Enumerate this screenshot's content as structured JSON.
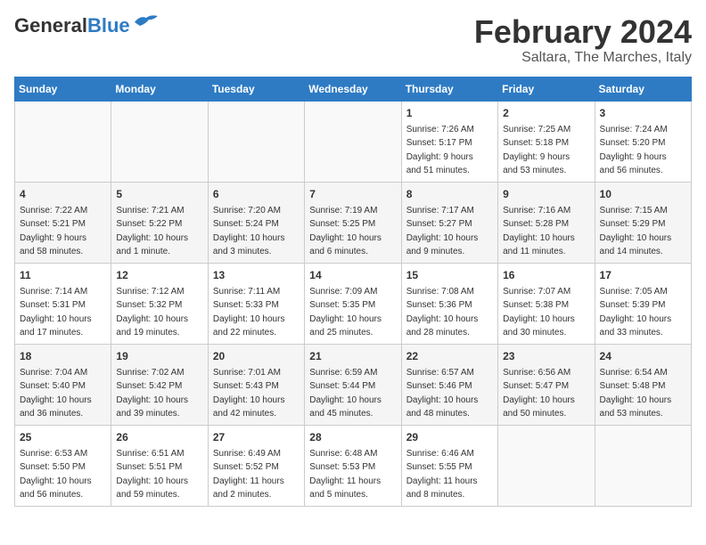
{
  "logo": {
    "general": "General",
    "blue": "Blue"
  },
  "title": "February 2024",
  "location": "Saltara, The Marches, Italy",
  "days_of_week": [
    "Sunday",
    "Monday",
    "Tuesday",
    "Wednesday",
    "Thursday",
    "Friday",
    "Saturday"
  ],
  "weeks": [
    [
      {
        "day": "",
        "info": ""
      },
      {
        "day": "",
        "info": ""
      },
      {
        "day": "",
        "info": ""
      },
      {
        "day": "",
        "info": ""
      },
      {
        "day": "1",
        "info": "Sunrise: 7:26 AM\nSunset: 5:17 PM\nDaylight: 9 hours\nand 51 minutes."
      },
      {
        "day": "2",
        "info": "Sunrise: 7:25 AM\nSunset: 5:18 PM\nDaylight: 9 hours\nand 53 minutes."
      },
      {
        "day": "3",
        "info": "Sunrise: 7:24 AM\nSunset: 5:20 PM\nDaylight: 9 hours\nand 56 minutes."
      }
    ],
    [
      {
        "day": "4",
        "info": "Sunrise: 7:22 AM\nSunset: 5:21 PM\nDaylight: 9 hours\nand 58 minutes."
      },
      {
        "day": "5",
        "info": "Sunrise: 7:21 AM\nSunset: 5:22 PM\nDaylight: 10 hours\nand 1 minute."
      },
      {
        "day": "6",
        "info": "Sunrise: 7:20 AM\nSunset: 5:24 PM\nDaylight: 10 hours\nand 3 minutes."
      },
      {
        "day": "7",
        "info": "Sunrise: 7:19 AM\nSunset: 5:25 PM\nDaylight: 10 hours\nand 6 minutes."
      },
      {
        "day": "8",
        "info": "Sunrise: 7:17 AM\nSunset: 5:27 PM\nDaylight: 10 hours\nand 9 minutes."
      },
      {
        "day": "9",
        "info": "Sunrise: 7:16 AM\nSunset: 5:28 PM\nDaylight: 10 hours\nand 11 minutes."
      },
      {
        "day": "10",
        "info": "Sunrise: 7:15 AM\nSunset: 5:29 PM\nDaylight: 10 hours\nand 14 minutes."
      }
    ],
    [
      {
        "day": "11",
        "info": "Sunrise: 7:14 AM\nSunset: 5:31 PM\nDaylight: 10 hours\nand 17 minutes."
      },
      {
        "day": "12",
        "info": "Sunrise: 7:12 AM\nSunset: 5:32 PM\nDaylight: 10 hours\nand 19 minutes."
      },
      {
        "day": "13",
        "info": "Sunrise: 7:11 AM\nSunset: 5:33 PM\nDaylight: 10 hours\nand 22 minutes."
      },
      {
        "day": "14",
        "info": "Sunrise: 7:09 AM\nSunset: 5:35 PM\nDaylight: 10 hours\nand 25 minutes."
      },
      {
        "day": "15",
        "info": "Sunrise: 7:08 AM\nSunset: 5:36 PM\nDaylight: 10 hours\nand 28 minutes."
      },
      {
        "day": "16",
        "info": "Sunrise: 7:07 AM\nSunset: 5:38 PM\nDaylight: 10 hours\nand 30 minutes."
      },
      {
        "day": "17",
        "info": "Sunrise: 7:05 AM\nSunset: 5:39 PM\nDaylight: 10 hours\nand 33 minutes."
      }
    ],
    [
      {
        "day": "18",
        "info": "Sunrise: 7:04 AM\nSunset: 5:40 PM\nDaylight: 10 hours\nand 36 minutes."
      },
      {
        "day": "19",
        "info": "Sunrise: 7:02 AM\nSunset: 5:42 PM\nDaylight: 10 hours\nand 39 minutes."
      },
      {
        "day": "20",
        "info": "Sunrise: 7:01 AM\nSunset: 5:43 PM\nDaylight: 10 hours\nand 42 minutes."
      },
      {
        "day": "21",
        "info": "Sunrise: 6:59 AM\nSunset: 5:44 PM\nDaylight: 10 hours\nand 45 minutes."
      },
      {
        "day": "22",
        "info": "Sunrise: 6:57 AM\nSunset: 5:46 PM\nDaylight: 10 hours\nand 48 minutes."
      },
      {
        "day": "23",
        "info": "Sunrise: 6:56 AM\nSunset: 5:47 PM\nDaylight: 10 hours\nand 50 minutes."
      },
      {
        "day": "24",
        "info": "Sunrise: 6:54 AM\nSunset: 5:48 PM\nDaylight: 10 hours\nand 53 minutes."
      }
    ],
    [
      {
        "day": "25",
        "info": "Sunrise: 6:53 AM\nSunset: 5:50 PM\nDaylight: 10 hours\nand 56 minutes."
      },
      {
        "day": "26",
        "info": "Sunrise: 6:51 AM\nSunset: 5:51 PM\nDaylight: 10 hours\nand 59 minutes."
      },
      {
        "day": "27",
        "info": "Sunrise: 6:49 AM\nSunset: 5:52 PM\nDaylight: 11 hours\nand 2 minutes."
      },
      {
        "day": "28",
        "info": "Sunrise: 6:48 AM\nSunset: 5:53 PM\nDaylight: 11 hours\nand 5 minutes."
      },
      {
        "day": "29",
        "info": "Sunrise: 6:46 AM\nSunset: 5:55 PM\nDaylight: 11 hours\nand 8 minutes."
      },
      {
        "day": "",
        "info": ""
      },
      {
        "day": "",
        "info": ""
      }
    ]
  ]
}
